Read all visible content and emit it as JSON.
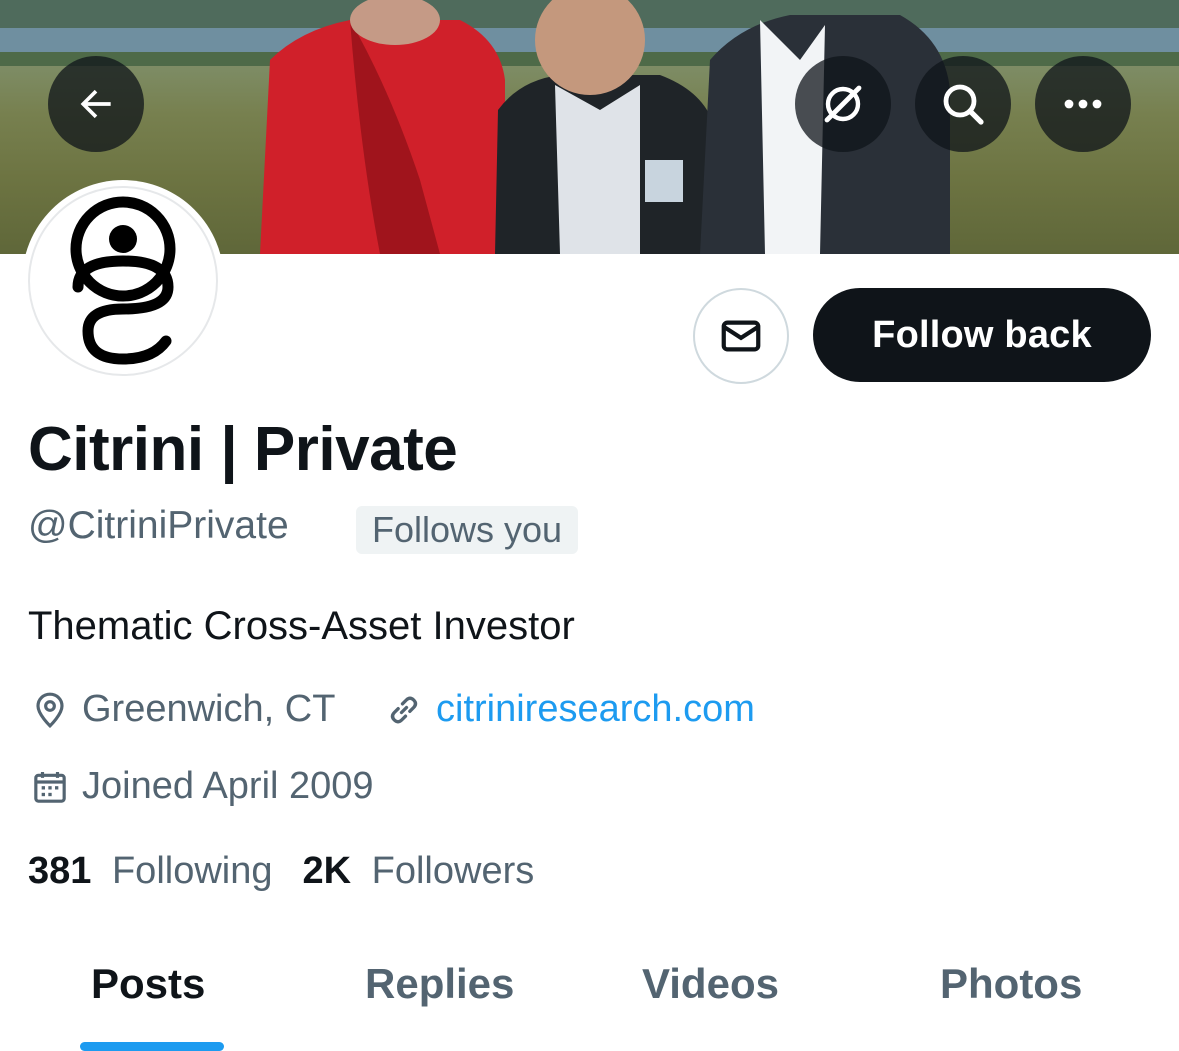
{
  "profile": {
    "display_name": "Citrini | Private",
    "handle": "@CitriniPrivate",
    "follows_you": "Follows you",
    "bio": "Thematic Cross-Asset Investor",
    "location": "Greenwich, CT",
    "website": "citriniresearch.com",
    "joined": "Joined April 2009"
  },
  "stats": {
    "following_count": "381",
    "following_label": "Following",
    "followers_count": "2K",
    "followers_label": "Followers"
  },
  "actions": {
    "follow_back": "Follow back"
  },
  "tabs": [
    {
      "label": "Posts",
      "active": true
    },
    {
      "label": "Replies",
      "active": false
    },
    {
      "label": "Videos",
      "active": false
    },
    {
      "label": "Photos",
      "active": false
    }
  ],
  "icons": {
    "back": "arrow-left-icon",
    "grok": "grok-icon",
    "search": "search-icon",
    "more": "more-icon",
    "message": "envelope-icon",
    "location": "location-pin-icon",
    "link": "link-icon",
    "calendar": "calendar-icon"
  },
  "colors": {
    "accent": "#1d9bf0",
    "text_primary": "#0f1419",
    "text_secondary": "#536471",
    "button_dark": "#0f1419"
  }
}
